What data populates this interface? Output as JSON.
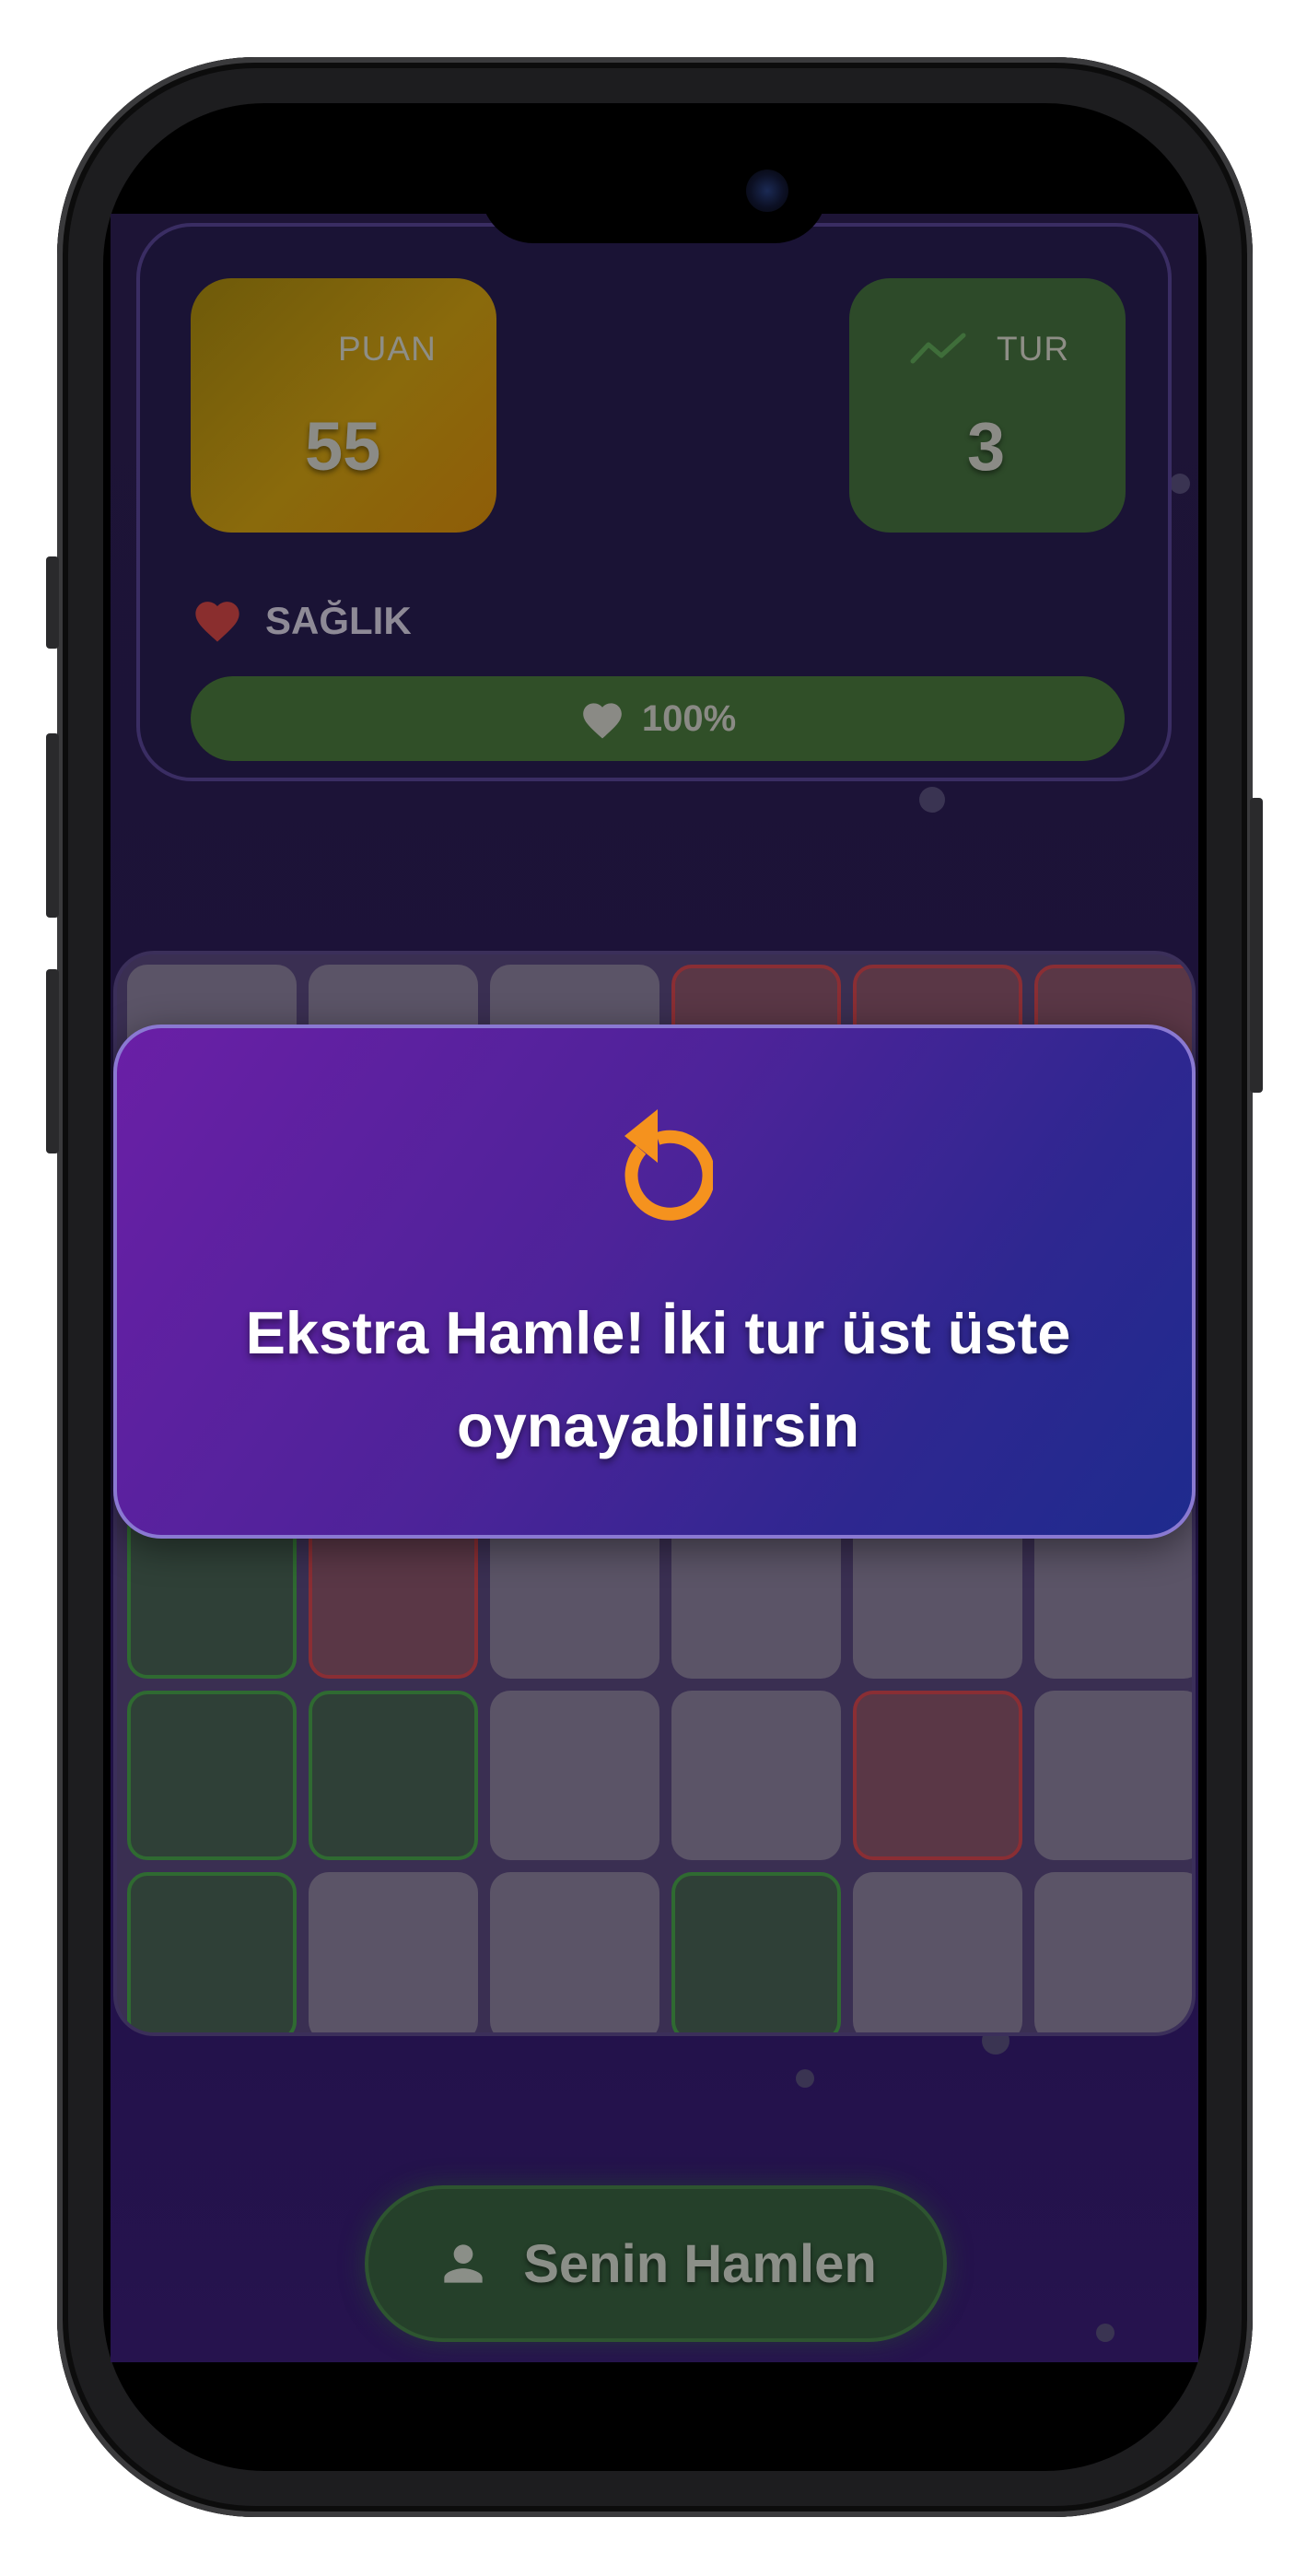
{
  "stats": {
    "score": {
      "label": "PUAN",
      "value": "55"
    },
    "round": {
      "label": "TUR",
      "value": "3"
    },
    "health": {
      "label": "SAĞLIK",
      "value_text": "100%",
      "percent": 100
    }
  },
  "board": {
    "columns": 6,
    "rows": 6,
    "cells": [
      [
        "neutral",
        "neutral",
        "neutral",
        "red",
        "red",
        "red"
      ],
      [
        "neutral",
        "neutral",
        "neutral",
        "neutral",
        "neutral",
        "neutral"
      ],
      [
        "neutral",
        "neutral",
        "neutral",
        "neutral",
        "neutral",
        "neutral"
      ],
      [
        "green",
        "red",
        "neutral",
        "neutral",
        "neutral",
        "neutral"
      ],
      [
        "green",
        "green",
        "neutral",
        "neutral",
        "red",
        "neutral"
      ],
      [
        "green",
        "neutral",
        "neutral",
        "green",
        "neutral",
        "neutral"
      ]
    ]
  },
  "toast": {
    "icon": "undo-icon",
    "line1": "Ekstra Hamle! İki tur üst üste",
    "line2": "oynayabilirsin"
  },
  "turn_button": {
    "label": "Senin Hamlen",
    "icon": "person-icon"
  },
  "colors": {
    "accent_orange": "#F5921E",
    "toast_start": "#6A1FA6",
    "toast_end": "#1E2B8E",
    "health_green": "#304F28",
    "heart_red": "#8A2E2E"
  }
}
